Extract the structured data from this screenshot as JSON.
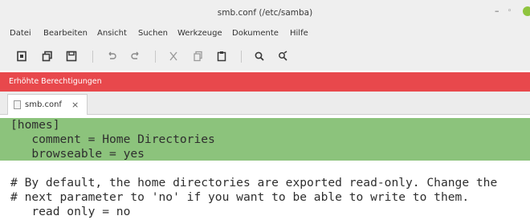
{
  "window": {
    "title": "smb.conf (/etc/samba)",
    "minimize_glyph": "–",
    "maximize_glyph": "◦"
  },
  "menu": [
    "Datei",
    "Bearbeiten",
    "Ansicht",
    "Suchen",
    "Werkzeuge",
    "Dokumente",
    "Hilfe"
  ],
  "toolbar": {
    "icons": [
      "new-document-icon",
      "open-icon",
      "save-icon",
      "undo-icon",
      "redo-icon",
      "cut-icon",
      "copy-icon",
      "paste-icon",
      "search-icon",
      "replace-icon"
    ]
  },
  "infobar": {
    "text": "Erhöhte Berechtigungen",
    "color": "#e8484c"
  },
  "tab": {
    "label": "smb.conf",
    "close": "×"
  },
  "editor": {
    "highlight_color": "#8cc37c",
    "lines": [
      "[homes]",
      "   comment = Home Directories",
      "   browseable = yes",
      "",
      "# By default, the home directories are exported read-only. Change the",
      "# next parameter to 'no' if you want to be able to write to them.",
      "   read only = no"
    ]
  }
}
